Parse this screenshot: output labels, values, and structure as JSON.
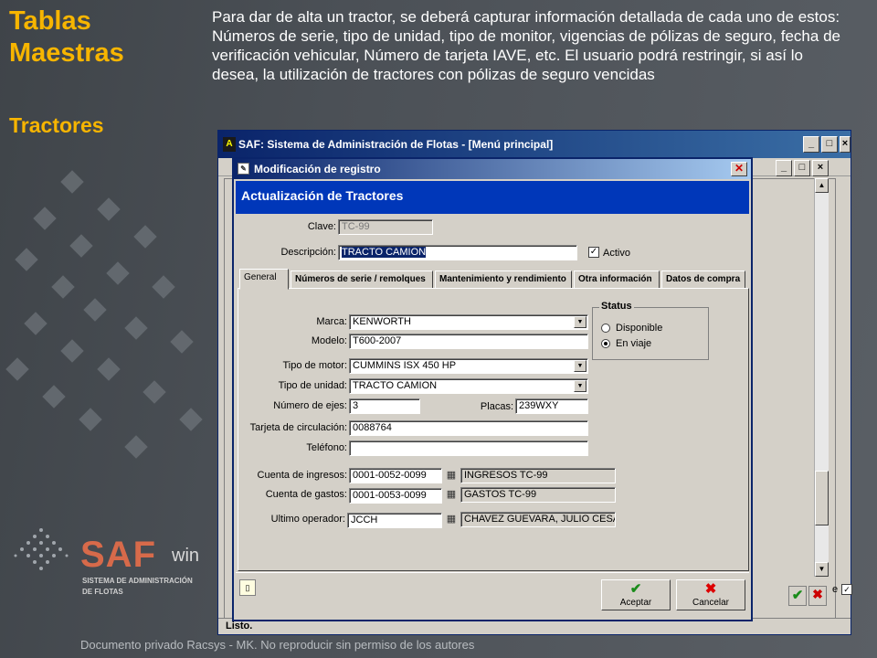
{
  "slide": {
    "title_line1": "Tablas",
    "title_line2": "Maestras",
    "subtitle": "Tractores",
    "description": "Para dar de alta un tractor, se deberá capturar información detallada de cada uno de estos: Números de serie, tipo de unidad, tipo de monitor, vigencias de pólizas de seguro, fecha de verificación vehicular, Número de tarjeta IAVE, etc. El usuario podrá restringir, si así lo desea, la utilización de tractores con pólizas de seguro vencidas",
    "footer": "Documento privado Racsys - MK. No reproducir sin permiso de los autores",
    "logo_saf": "SAF",
    "logo_win": "win",
    "logo_line1": "SISTEMA DE ADMINISTRACIÓN",
    "logo_line2": "DE FLOTAS",
    "colors": {
      "title": "#f7b500",
      "logo": "#d76a4a"
    }
  },
  "main_window": {
    "title": "SAF: Sistema de Administración de Flotas - [Menú principal]",
    "status": "Listo.",
    "side_label": "e"
  },
  "dialog": {
    "title": "Modificación de registro",
    "header": "Actualización de Tractores",
    "clave_label": "Clave:",
    "clave_value": "TC-99",
    "descripcion_label": "Descripción:",
    "descripcion_value": "TRACTO CAMION",
    "activo_label": "Activo",
    "activo_checked": true,
    "tabs": [
      {
        "label": "General",
        "active": true
      },
      {
        "label": "Números de serie / remolques",
        "active": false
      },
      {
        "label": "Mantenimiento y rendimiento",
        "active": false
      },
      {
        "label": "Otra información",
        "active": false
      },
      {
        "label": "Datos de compra",
        "active": false
      }
    ],
    "fields": {
      "marca_label": "Marca:",
      "marca_value": "KENWORTH",
      "modelo_label": "Modelo:",
      "modelo_value": "T600-2007",
      "motor_label": "Tipo de motor:",
      "motor_value": "CUMMINS ISX 450 HP",
      "unidad_label": "Tipo de unidad:",
      "unidad_value": "TRACTO CAMION",
      "ejes_label": "Número de ejes:",
      "ejes_value": "3",
      "placas_label": "Placas:",
      "placas_value": "239WXY",
      "tarjeta_label": "Tarjeta de circulación:",
      "tarjeta_value": "0088764",
      "telefono_label": "Teléfono:",
      "telefono_value": "",
      "ingresos_label": "Cuenta de ingresos:",
      "ingresos_value": "0001-0052-0099",
      "ingresos_desc": "INGRESOS TC-99",
      "gastos_label": "Cuenta de gastos:",
      "gastos_value": "0001-0053-0099",
      "gastos_desc": "GASTOS TC-99",
      "operador_label": "Ultimo operador:",
      "operador_value": "JCCH",
      "operador_desc": "CHAVEZ GUEVARA, JULIO CESAR"
    },
    "status_group": {
      "title": "Status",
      "options": [
        {
          "label": "Disponible",
          "selected": false
        },
        {
          "label": "En viaje",
          "selected": true
        }
      ]
    },
    "buttons": {
      "accept": "Aceptar",
      "cancel": "Cancelar"
    }
  }
}
